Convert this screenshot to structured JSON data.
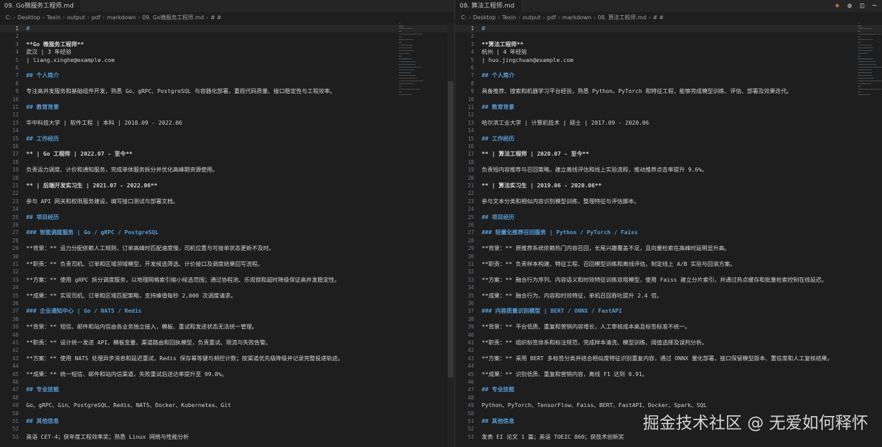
{
  "left": {
    "tab": {
      "label": "09.       Go微服务工程师.md"
    },
    "breadcrumbs": [
      "C:",
      "Desktop",
      "Texin",
      "output",
      "pdf",
      "markdown",
      "09.   Go微服务工程师.md",
      "# #"
    ],
    "lines": [
      {
        "n": "1",
        "t": "#  ",
        "c": "h"
      },
      {
        "n": "2",
        "t": "",
        "c": ""
      },
      {
        "n": "3",
        "t": "**Go 微服务工程师**",
        "c": "b"
      },
      {
        "n": "4",
        "t": "武汉 | 3 年经验",
        "c": ""
      },
      {
        "n": "5",
        "t": "        | liang.xinghe@example.com",
        "c": ""
      },
      {
        "n": "6",
        "t": "",
        "c": ""
      },
      {
        "n": "7",
        "t": "## 个人简介",
        "c": "h"
      },
      {
        "n": "8",
        "t": "",
        "c": ""
      },
      {
        "n": "9",
        "t": "专注高并发服务和基础组件开发，熟悉 Go、gRPC、PostgreSQL 与容器化部署，重视代码质量、接口稳定性与工程效率。",
        "c": ""
      },
      {
        "n": "10",
        "t": "",
        "c": ""
      },
      {
        "n": "11",
        "t": "## 教育背景",
        "c": "h"
      },
      {
        "n": "12",
        "t": "",
        "c": ""
      },
      {
        "n": "13",
        "t": "华中科技大学 | 软件工程 | 本科 | 2018.09 - 2022.06",
        "c": ""
      },
      {
        "n": "14",
        "t": "",
        "c": ""
      },
      {
        "n": "15",
        "t": "## 工作经历",
        "c": "h"
      },
      {
        "n": "16",
        "t": "",
        "c": ""
      },
      {
        "n": "17",
        "t": "**          | Go 工程师 | 2022.07 - 至今**",
        "c": "b"
      },
      {
        "n": "18",
        "t": "",
        "c": ""
      },
      {
        "n": "19",
        "t": "负责运力调度、计价和通知服务，完成单体服务拆分并优化高峰期资源使用。",
        "c": ""
      },
      {
        "n": "20",
        "t": "",
        "c": ""
      },
      {
        "n": "21",
        "t": "**       | 后端开发实习生 | 2021.07 - 2022.06**",
        "c": "b"
      },
      {
        "n": "22",
        "t": "",
        "c": ""
      },
      {
        "n": "23",
        "t": "参与 API 网关和权限服务建设，编写接口测试与部署文档。",
        "c": ""
      },
      {
        "n": "24",
        "t": "",
        "c": ""
      },
      {
        "n": "25",
        "t": "## 项目经历",
        "c": "h"
      },
      {
        "n": "26",
        "t": "",
        "c": ""
      },
      {
        "n": "27",
        "t": "### 智能调度服务 | Go / gRPC / PostgreSQL",
        "c": "h"
      },
      {
        "n": "28",
        "t": "",
        "c": ""
      },
      {
        "n": "29",
        "t": "**背景：** 运力分配依赖人工规则，订单高峰时匹配速度慢，司机位置与可接单状态更新不及时。",
        "c": ""
      },
      {
        "n": "30",
        "t": "",
        "c": ""
      },
      {
        "n": "31",
        "t": "**职责：** 负责司机、订单和区域领域模型，开发候选筛选、计价接口及调度结果回写流程。",
        "c": ""
      },
      {
        "n": "32",
        "t": "",
        "c": ""
      },
      {
        "n": "33",
        "t": "**方案：** 使用 gRPC 拆分调度服务，以地理网格索引缩小候选范围；通过协程池、乐观锁和超时降级保证高并发稳定性。",
        "c": ""
      },
      {
        "n": "34",
        "t": "",
        "c": ""
      },
      {
        "n": "35",
        "t": "**成果：** 实现司机、订单和区域匹配策略，支持峰值每秒 2,000 次调度请求。",
        "c": ""
      },
      {
        "n": "36",
        "t": "",
        "c": ""
      },
      {
        "n": "37",
        "t": "### 企业通知中心 | Go / NATS / Redis",
        "c": "h"
      },
      {
        "n": "38",
        "t": "",
        "c": ""
      },
      {
        "n": "39",
        "t": "**背景：** 短信、邮件和站内信由各业务独立接入，模板、重试和发送状态无法统一管理。",
        "c": ""
      },
      {
        "n": "40",
        "t": "",
        "c": ""
      },
      {
        "n": "41",
        "t": "**职责：** 设计统一发送 API、模板变量、渠道路由和回执模型，负责重试、限流与失败告警。",
        "c": ""
      },
      {
        "n": "42",
        "t": "",
        "c": ""
      },
      {
        "n": "43",
        "t": "**方案：** 使用 NATS 处理异步消息和延迟重试，Redis 保存幂等键与频控计数；按渠道优先级降级并记录完整投递轨迹。",
        "c": ""
      },
      {
        "n": "44",
        "t": "",
        "c": ""
      },
      {
        "n": "45",
        "t": "**成果：** 统一短信、邮件和站内信渠道，失败重试后送达率提升至 99.8%。",
        "c": ""
      },
      {
        "n": "46",
        "t": "",
        "c": ""
      },
      {
        "n": "47",
        "t": "## 专业技能",
        "c": "h"
      },
      {
        "n": "48",
        "t": "",
        "c": ""
      },
      {
        "n": "49",
        "t": "Go、gRPC、Gin、PostgreSQL、Redis、NATS、Docker、Kubernetes、Git",
        "c": ""
      },
      {
        "n": "50",
        "t": "",
        "c": ""
      },
      {
        "n": "51",
        "t": "## 其他信息",
        "c": "h"
      },
      {
        "n": "52",
        "t": "",
        "c": ""
      },
      {
        "n": "53",
        "t": "英语 CET-4；获年度工程效率奖；熟悉 Linux 网络与性能分析",
        "c": ""
      }
    ]
  },
  "right": {
    "tab": {
      "label": "08.       算法工程师.md"
    },
    "breadcrumbs": [
      "C:",
      "Desktop",
      "Texin",
      "output",
      "pdf",
      "markdown",
      "08.    算法工程师.md",
      "# #"
    ],
    "lines": [
      {
        "n": "1",
        "t": "#  ",
        "c": "h"
      },
      {
        "n": "2",
        "t": "",
        "c": ""
      },
      {
        "n": "3",
        "t": "**算法工程师**",
        "c": "b"
      },
      {
        "n": "4",
        "t": "杭州 | 4 年经验",
        "c": ""
      },
      {
        "n": "5",
        "t": "         | huo.jingchuan@example.com",
        "c": ""
      },
      {
        "n": "6",
        "t": "",
        "c": ""
      },
      {
        "n": "7",
        "t": "## 个人简介",
        "c": "h"
      },
      {
        "n": "8",
        "t": "",
        "c": ""
      },
      {
        "n": "9",
        "t": "具备推荐、搜索和机器学习平台经验，熟悉 Python、PyTorch 和特征工程，能够完成模型训练、评估、部署及效果迭代。",
        "c": ""
      },
      {
        "n": "10",
        "t": "",
        "c": ""
      },
      {
        "n": "11",
        "t": "## 教育背景",
        "c": "h"
      },
      {
        "n": "12",
        "t": "",
        "c": ""
      },
      {
        "n": "13",
        "t": "哈尔滨工业大学 | 计算机技术 | 硕士 | 2017.09 - 2020.06",
        "c": ""
      },
      {
        "n": "14",
        "t": "",
        "c": ""
      },
      {
        "n": "15",
        "t": "## 工作经历",
        "c": "h"
      },
      {
        "n": "16",
        "t": "",
        "c": ""
      },
      {
        "n": "17",
        "t": "**          | 算法工程师 | 2020.07 - 至今**",
        "c": "b"
      },
      {
        "n": "18",
        "t": "",
        "c": ""
      },
      {
        "n": "19",
        "t": "负责短内容推荐与召回策略，建立离线评估和线上实验流程，推动推荐点击率提升 9.6%。",
        "c": ""
      },
      {
        "n": "20",
        "t": "",
        "c": ""
      },
      {
        "n": "21",
        "t": "**        | 算法实习生 | 2019.06 - 2020.06**",
        "c": "b"
      },
      {
        "n": "22",
        "t": "",
        "c": ""
      },
      {
        "n": "23",
        "t": "参与文本分类和相似内容识别模型训练，整理特征与评估脚本。",
        "c": ""
      },
      {
        "n": "24",
        "t": "",
        "c": ""
      },
      {
        "n": "25",
        "t": "## 项目经历",
        "c": "h"
      },
      {
        "n": "26",
        "t": "",
        "c": ""
      },
      {
        "n": "27",
        "t": "### 轻量化推荐召回服务 | Python / PyTorch / Faiss",
        "c": "h"
      },
      {
        "n": "28",
        "t": "",
        "c": ""
      },
      {
        "n": "29",
        "t": "**背景：** 原推荐系统依赖热门内容召回，长尾兴趣覆盖不足，且向量检索在高峰时延明显升高。",
        "c": ""
      },
      {
        "n": "30",
        "t": "",
        "c": ""
      },
      {
        "n": "31",
        "t": "**职责：** 负责样本构建、特征工程、召回模型训练和离线评估，制定线上 A/B 实验与回滚方案。",
        "c": ""
      },
      {
        "n": "32",
        "t": "",
        "c": ""
      },
      {
        "n": "33",
        "t": "**方案：** 融合行为序列、内容语义和时效特征训练双塔模型，使用 Faiss 建立分片索引，并通过热点缓存和批量检索控制在线延迟。",
        "c": ""
      },
      {
        "n": "34",
        "t": "",
        "c": ""
      },
      {
        "n": "35",
        "t": "**成果：** 融合行为、内容和时效特征，单机召回吞吐提升 2.4 倍。",
        "c": ""
      },
      {
        "n": "36",
        "t": "",
        "c": ""
      },
      {
        "n": "37",
        "t": "### 内容质量识别模型 | BERT / ONNX / FastAPI",
        "c": "h"
      },
      {
        "n": "38",
        "t": "",
        "c": ""
      },
      {
        "n": "39",
        "t": "**背景：** 平台低质、重复和营销内容增长，人工审核成本高且标签标准不统一。",
        "c": ""
      },
      {
        "n": "40",
        "t": "",
        "c": ""
      },
      {
        "n": "41",
        "t": "**职责：** 组织标签体系和标注规范，完成样本清洗、模型训练、阈值选择及误判分析。",
        "c": ""
      },
      {
        "n": "42",
        "t": "",
        "c": ""
      },
      {
        "n": "43",
        "t": "**方案：** 采用 BERT 多标签分类并结合相似度特征识别重复内容，通过 ONNX 量化部署，接口保留模型版本、置信度和人工复核结果。",
        "c": ""
      },
      {
        "n": "44",
        "t": "",
        "c": ""
      },
      {
        "n": "45",
        "t": "**成果：** 识别低质、重复和营销内容，离线 F1 达到 0.91。",
        "c": ""
      },
      {
        "n": "46",
        "t": "",
        "c": ""
      },
      {
        "n": "47",
        "t": "## 专业技能",
        "c": "h"
      },
      {
        "n": "48",
        "t": "",
        "c": ""
      },
      {
        "n": "49",
        "t": "Python、PyTorch、TensorFlow、Faiss、BERT、FastAPI、Docker、Spark、SQL",
        "c": ""
      },
      {
        "n": "50",
        "t": "",
        "c": ""
      },
      {
        "n": "51",
        "t": "## 其他信息",
        "c": "h"
      },
      {
        "n": "52",
        "t": "",
        "c": ""
      },
      {
        "n": "53",
        "t": "发表 EI 论文 1 篇；英语 TOEIC 860；获技术创新奖",
        "c": ""
      }
    ]
  },
  "watermark": "掘金技术社区 @ 无爱如何释怀",
  "icons": [
    "tab-markdown-icon",
    "open-changes-icon",
    "split-editor-icon",
    "more-actions-icon"
  ],
  "colors": {
    "heading": "#569cd6",
    "background": "#1e1e1e",
    "text": "#d4d4d4"
  }
}
